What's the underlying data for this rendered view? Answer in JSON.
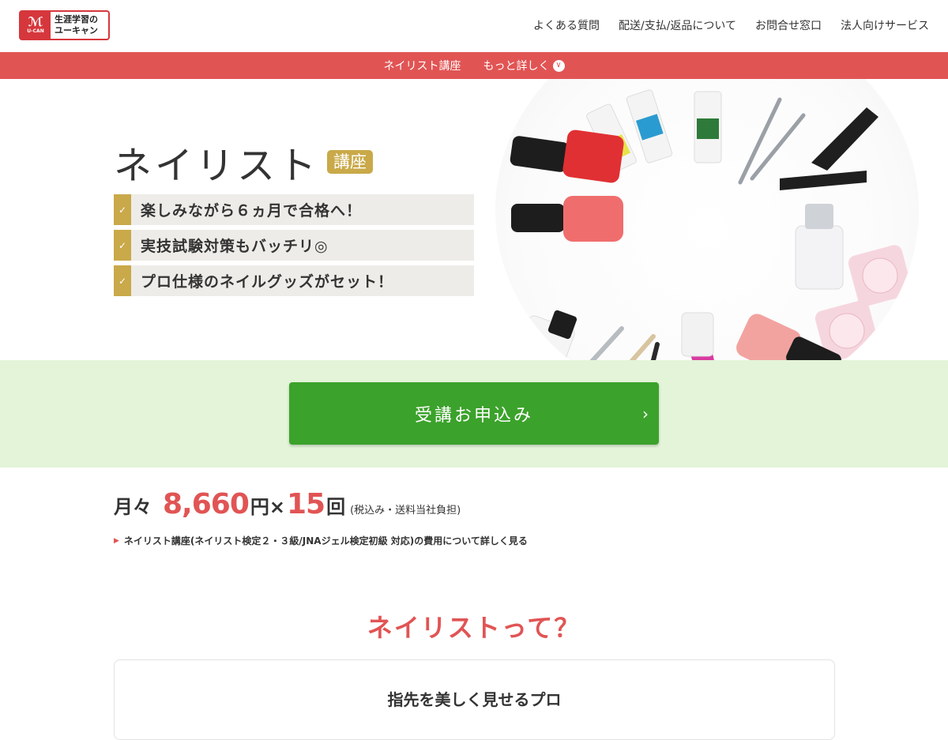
{
  "header": {
    "logo": {
      "mark": "ℳ",
      "mark_en": "U-CAN",
      "line1": "生涯学習の",
      "line2": "ユーキャン"
    },
    "nav": [
      "よくある質問",
      "配送/支払/返品について",
      "お問合せ窓口",
      "法人向けサービス"
    ]
  },
  "subnav": {
    "course": "ネイリスト講座",
    "more": "もっと詳しく",
    "more_icon": "chevron-down-icon"
  },
  "hero": {
    "title": "ネイリスト",
    "badge": "講座",
    "points": [
      "楽しみながら６ヵ月で合格へ！",
      "実技試験対策もバッチリ◎",
      "プロ仕様のネイルグッズがセット！"
    ]
  },
  "cta": {
    "label": "受講お申込み"
  },
  "price": {
    "prefix": "月々",
    "amount": "8,660",
    "unit": "円×",
    "count": "15",
    "count_unit": "回",
    "note": "(税込み・送料当社負担)",
    "link": "ネイリスト講座(ネイリスト検定２・３級/JNAジェル検定初級 対応)の費用について詳しく見る"
  },
  "section": {
    "title": "ネイリストって？",
    "card_title": "指先を美しく見せるプロ"
  },
  "colors": {
    "brand_red": "#e15454",
    "gold": "#c9a949",
    "cta_green": "#3ba22b",
    "cta_band": "#e3f4d8"
  }
}
